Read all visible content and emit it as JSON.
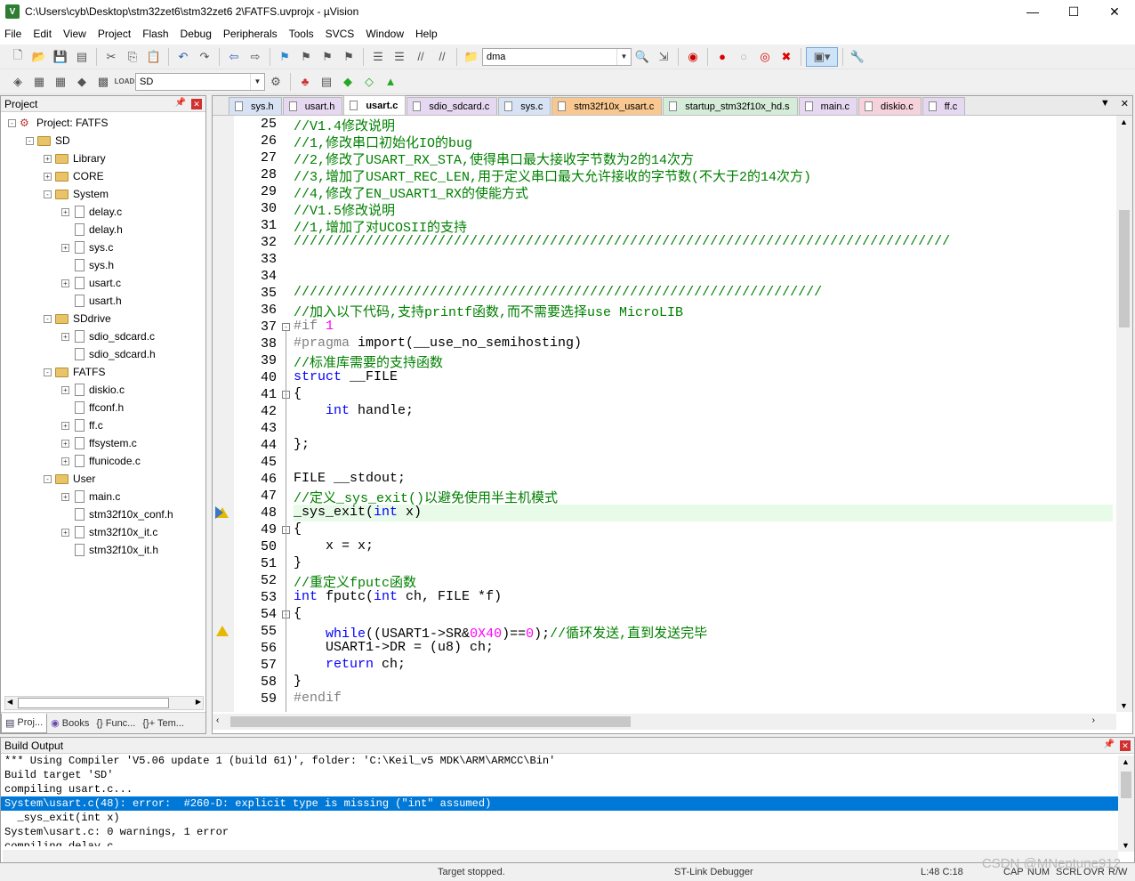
{
  "window": {
    "title": "C:\\Users\\cyb\\Desktop\\stm32zet6\\stm32zet6 2\\FATFS.uvprojx - µVision"
  },
  "menu": [
    "File",
    "Edit",
    "View",
    "Project",
    "Flash",
    "Debug",
    "Peripherals",
    "Tools",
    "SVCS",
    "Window",
    "Help"
  ],
  "toolbar": {
    "find_value": "dma",
    "target_value": "SD"
  },
  "project_panel": {
    "title": "Project",
    "tree": [
      {
        "label": "Project: FATFS",
        "level": 0,
        "type": "project",
        "exp": "-"
      },
      {
        "label": "SD",
        "level": 1,
        "type": "folder",
        "exp": "-"
      },
      {
        "label": "Library",
        "level": 2,
        "type": "folder",
        "exp": "+"
      },
      {
        "label": "CORE",
        "level": 2,
        "type": "folder",
        "exp": "+"
      },
      {
        "label": "System",
        "level": 2,
        "type": "folder",
        "exp": "-"
      },
      {
        "label": "delay.c",
        "level": 3,
        "type": "file",
        "exp": "+"
      },
      {
        "label": "delay.h",
        "level": 3,
        "type": "file",
        "exp": ""
      },
      {
        "label": "sys.c",
        "level": 3,
        "type": "file",
        "exp": "+"
      },
      {
        "label": "sys.h",
        "level": 3,
        "type": "file",
        "exp": ""
      },
      {
        "label": "usart.c",
        "level": 3,
        "type": "file",
        "exp": "+"
      },
      {
        "label": "usart.h",
        "level": 3,
        "type": "file",
        "exp": ""
      },
      {
        "label": "SDdrive",
        "level": 2,
        "type": "folder",
        "exp": "-"
      },
      {
        "label": "sdio_sdcard.c",
        "level": 3,
        "type": "file",
        "exp": "+"
      },
      {
        "label": "sdio_sdcard.h",
        "level": 3,
        "type": "file",
        "exp": ""
      },
      {
        "label": "FATFS",
        "level": 2,
        "type": "folder",
        "exp": "-"
      },
      {
        "label": "diskio.c",
        "level": 3,
        "type": "file",
        "exp": "+"
      },
      {
        "label": "ffconf.h",
        "level": 3,
        "type": "file",
        "exp": ""
      },
      {
        "label": "ff.c",
        "level": 3,
        "type": "file",
        "exp": "+"
      },
      {
        "label": "ffsystem.c",
        "level": 3,
        "type": "file",
        "exp": "+"
      },
      {
        "label": "ffunicode.c",
        "level": 3,
        "type": "file",
        "exp": "+"
      },
      {
        "label": "User",
        "level": 2,
        "type": "folder",
        "exp": "-"
      },
      {
        "label": "main.c",
        "level": 3,
        "type": "file",
        "exp": "+"
      },
      {
        "label": "stm32f10x_conf.h",
        "level": 3,
        "type": "file",
        "exp": ""
      },
      {
        "label": "stm32f10x_it.c",
        "level": 3,
        "type": "file",
        "exp": "+"
      },
      {
        "label": "stm32f10x_it.h",
        "level": 3,
        "type": "file",
        "exp": ""
      }
    ],
    "bottom_tabs": [
      "Proj...",
      "Books",
      "{} Func...",
      "{}+ Tem..."
    ]
  },
  "editor": {
    "tabs": [
      {
        "label": "sys.h",
        "color": "#d7e3f4",
        "active": false
      },
      {
        "label": "usart.h",
        "color": "#e6d8f0",
        "active": false
      },
      {
        "label": "usart.c",
        "color": "#ffffff",
        "active": true
      },
      {
        "label": "sdio_sdcard.c",
        "color": "#e6d8f0",
        "active": false
      },
      {
        "label": "sys.c",
        "color": "#d7e3f4",
        "active": false
      },
      {
        "label": "stm32f10x_usart.c",
        "color": "#f9c890",
        "active": false
      },
      {
        "label": "startup_stm32f10x_hd.s",
        "color": "#d5edd8",
        "active": false
      },
      {
        "label": "main.c",
        "color": "#e6d8f0",
        "active": false
      },
      {
        "label": "diskio.c",
        "color": "#f6d2dc",
        "active": false
      },
      {
        "label": "ff.c",
        "color": "#e6d8f0",
        "active": false
      }
    ],
    "lines": [
      {
        "n": "25",
        "segs": [
          [
            "cm",
            "//V1.4修改说明"
          ]
        ]
      },
      {
        "n": "26",
        "segs": [
          [
            "cm",
            "//1,修改串口初始化IO的bug"
          ]
        ]
      },
      {
        "n": "27",
        "segs": [
          [
            "cm",
            "//2,修改了USART_RX_STA,使得串口最大接收字节数为2的14次方"
          ]
        ]
      },
      {
        "n": "28",
        "segs": [
          [
            "cm",
            "//3,增加了USART_REC_LEN,用于定义串口最大允许接收的字节数(不大于2的14次方)"
          ]
        ]
      },
      {
        "n": "29",
        "segs": [
          [
            "cm",
            "//4,修改了EN_USART1_RX的使能方式"
          ]
        ]
      },
      {
        "n": "30",
        "segs": [
          [
            "cm",
            "//V1.5修改说明"
          ]
        ]
      },
      {
        "n": "31",
        "segs": [
          [
            "cm",
            "//1,增加了对UCOSII的支持"
          ]
        ]
      },
      {
        "n": "32",
        "segs": [
          [
            "cm",
            "//////////////////////////////////////////////////////////////////////////////////"
          ]
        ]
      },
      {
        "n": "33",
        "segs": []
      },
      {
        "n": "34",
        "segs": []
      },
      {
        "n": "35",
        "segs": [
          [
            "cm",
            "//////////////////////////////////////////////////////////////////"
          ]
        ]
      },
      {
        "n": "36",
        "segs": [
          [
            "cm",
            "//加入以下代码,支持printf函数,而不需要选择use MicroLIB"
          ]
        ]
      },
      {
        "n": "37",
        "segs": [
          [
            "pp",
            "#if "
          ],
          [
            "num",
            "1"
          ]
        ],
        "fold": "-"
      },
      {
        "n": "38",
        "segs": [
          [
            "pp",
            "#pragma"
          ],
          [
            "tx",
            " import(__use_no_semihosting)"
          ]
        ]
      },
      {
        "n": "39",
        "segs": [
          [
            "cm",
            "//标准库需要的支持函数"
          ]
        ]
      },
      {
        "n": "40",
        "segs": [
          [
            "kw",
            "struct"
          ],
          [
            "tx",
            " __FILE"
          ]
        ]
      },
      {
        "n": "41",
        "segs": [
          [
            "tx",
            "{"
          ]
        ],
        "fold": "-"
      },
      {
        "n": "42",
        "segs": [
          [
            "tx",
            "    "
          ],
          [
            "kw",
            "int"
          ],
          [
            "tx",
            " handle;"
          ]
        ]
      },
      {
        "n": "43",
        "segs": []
      },
      {
        "n": "44",
        "segs": [
          [
            "tx",
            "};"
          ]
        ]
      },
      {
        "n": "45",
        "segs": []
      },
      {
        "n": "46",
        "segs": [
          [
            "tx",
            "FILE __stdout;"
          ]
        ]
      },
      {
        "n": "47",
        "segs": [
          [
            "cm",
            "//定义_sys_exit()以避免使用半主机模式"
          ]
        ]
      },
      {
        "n": "48",
        "segs": [
          [
            "tx",
            "_sys_exit("
          ],
          [
            "kw",
            "int"
          ],
          [
            "tx",
            " x)"
          ]
        ],
        "hl": true,
        "mark": "arrowwarn"
      },
      {
        "n": "49",
        "segs": [
          [
            "tx",
            "{"
          ]
        ],
        "fold": "-"
      },
      {
        "n": "50",
        "segs": [
          [
            "tx",
            "    x = x;"
          ]
        ]
      },
      {
        "n": "51",
        "segs": [
          [
            "tx",
            "}"
          ]
        ]
      },
      {
        "n": "52",
        "segs": [
          [
            "cm",
            "//重定义fputc函数"
          ]
        ]
      },
      {
        "n": "53",
        "segs": [
          [
            "kw",
            "int"
          ],
          [
            "tx",
            " fputc("
          ],
          [
            "kw",
            "int"
          ],
          [
            "tx",
            " ch, FILE *f)"
          ]
        ]
      },
      {
        "n": "54",
        "segs": [
          [
            "tx",
            "{"
          ]
        ],
        "fold": "-"
      },
      {
        "n": "55",
        "segs": [
          [
            "tx",
            "    "
          ],
          [
            "kw",
            "while"
          ],
          [
            "tx",
            "((USART1->SR&"
          ],
          [
            "num",
            "0X40"
          ],
          [
            "tx",
            ")=="
          ],
          [
            "num",
            "0"
          ],
          [
            "tx",
            ");"
          ],
          [
            "cm",
            "//循环发送,直到发送完毕"
          ]
        ],
        "mark": "warn"
      },
      {
        "n": "56",
        "segs": [
          [
            "tx",
            "    USART1->DR = (u8) ch;"
          ]
        ]
      },
      {
        "n": "57",
        "segs": [
          [
            "tx",
            "    "
          ],
          [
            "kw",
            "return"
          ],
          [
            "tx",
            " ch;"
          ]
        ]
      },
      {
        "n": "58",
        "segs": [
          [
            "tx",
            "}"
          ]
        ]
      },
      {
        "n": "59",
        "segs": [
          [
            "pp",
            "#endif"
          ]
        ]
      }
    ]
  },
  "build_output": {
    "title": "Build Output",
    "lines": [
      "*** Using Compiler 'V5.06 update 1 (build 61)', folder: 'C:\\Keil_v5 MDK\\ARM\\ARMCC\\Bin'",
      "Build target 'SD'",
      "compiling usart.c...",
      "System\\usart.c(48): error:  #260-D: explicit type is missing (\"int\" assumed)",
      "  _sys_exit(int x)",
      "System\\usart.c: 0 warnings, 1 error",
      "compiling delay.c..."
    ],
    "selected_index": 3
  },
  "status": {
    "target": "Target stopped.",
    "debugger": "ST-Link Debugger",
    "position": "L:48 C:18",
    "caps": "CAP",
    "num": "NUM",
    "scrl": "SCRL",
    "ovr": "OVR",
    "rw": "R/W"
  },
  "watermark": "CSDN @MNeptune912"
}
